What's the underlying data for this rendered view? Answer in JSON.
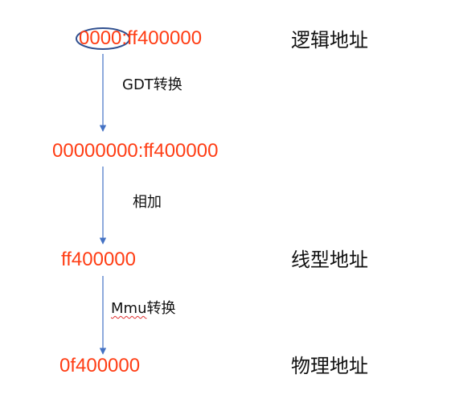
{
  "nodes": {
    "logical_address": "0000:ff400000",
    "linear_gdt_address": "00000000:ff400000",
    "linear_address": "ff400000",
    "physical_address": "0f400000"
  },
  "labels": {
    "logical": "逻辑地址",
    "linear": "线型地址",
    "physical": "物理地址"
  },
  "steps": {
    "gdt": "GDT转换",
    "add": "相加",
    "mmu_prefix": "Mmu",
    "mmu_suffix": "转换"
  },
  "colors": {
    "address": "#ff3d14",
    "arrow": "#4472c4",
    "highlight_ellipse": "#2f4f8f",
    "text": "#111111",
    "spellcheck": "#e03030"
  }
}
